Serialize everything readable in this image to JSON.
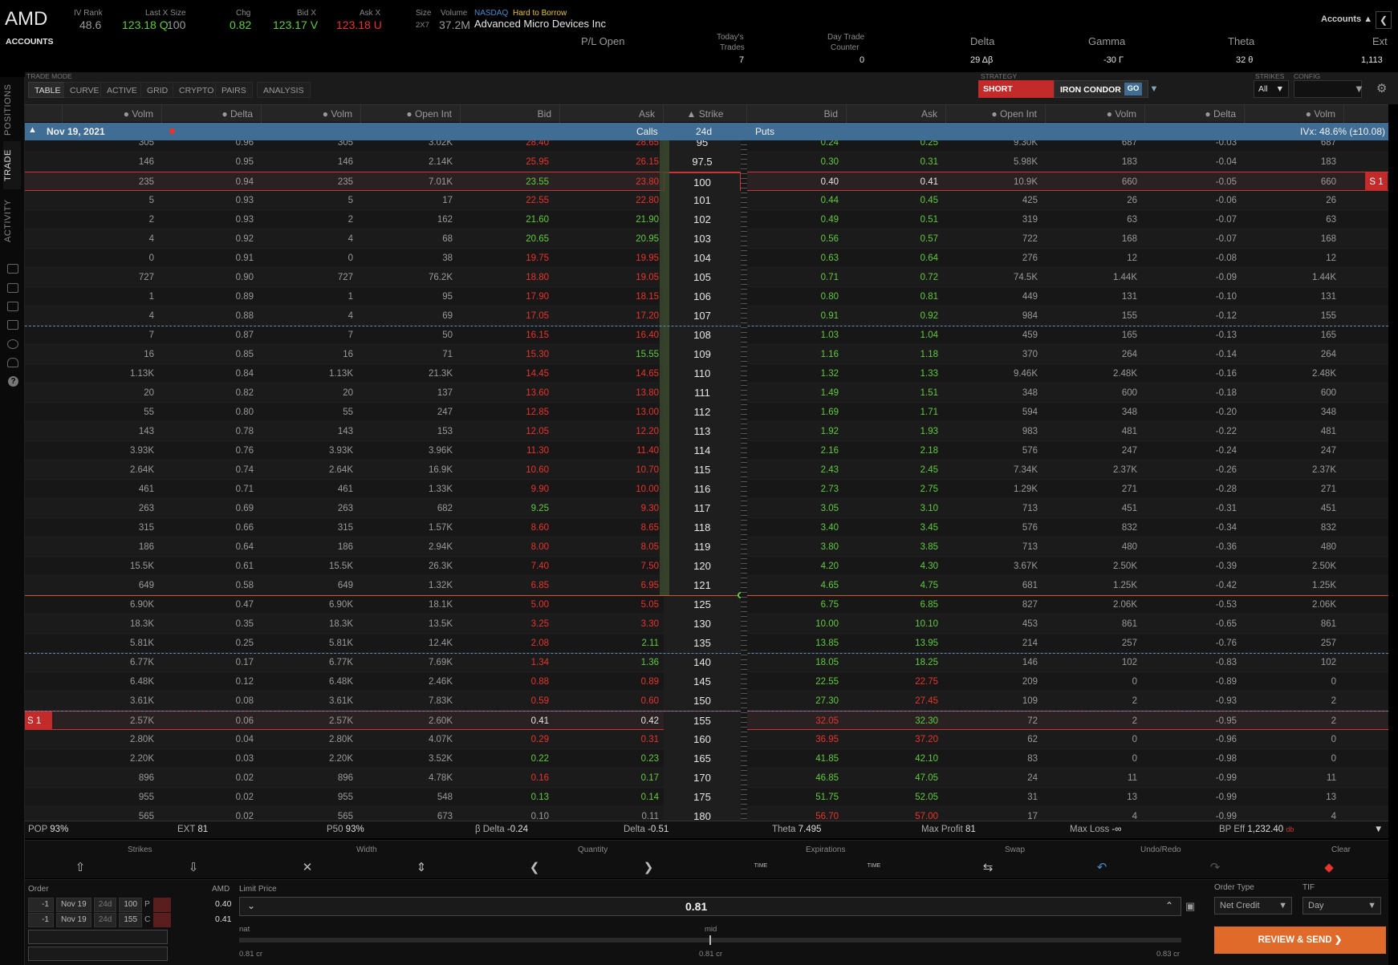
{
  "header": {
    "symbol": "AMD",
    "accounts_label": "ACCOUNTS",
    "iv_rank_label": "IV Rank",
    "iv_rank": "48.6",
    "last_label": "Last X Size",
    "last": "123.18 Q",
    "last_size": "100",
    "chg_label": "Chg",
    "chg": "0.82",
    "bid_label": "Bid X",
    "bid": "123.17 V",
    "ask_label": "Ask X",
    "ask": "123.18 U",
    "size_label": "Size",
    "size": "2X7",
    "volume_label": "Volume",
    "volume": "37.2M",
    "exchange": "NASDAQ",
    "htb": "Hard to Borrow",
    "company": "Advanced Micro Devices Inc",
    "accounts_btn": "Accounts",
    "pl_open_label": "P/L Open",
    "todays_trades_label1": "Today's",
    "todays_trades_label2": "Trades",
    "todays_trades": "7",
    "dtc_label1": "Day Trade",
    "dtc_label2": "Counter",
    "dtc": "0",
    "delta_label": "Delta",
    "delta": "29 Δβ",
    "gamma_label": "Gamma",
    "gamma": "-30 Γ",
    "theta_label": "Theta",
    "theta": "32 θ",
    "ext_label": "Ext",
    "ext": "1,113"
  },
  "sidebar": {
    "tabs": [
      "POSITIONS",
      "TRADE",
      "ACTIVITY"
    ]
  },
  "trade_mode": {
    "label": "TRADE MODE",
    "modes": [
      "TABLE",
      "CURVE",
      "ACTIVE",
      "GRID",
      "CRYPTO",
      "PAIRS",
      "ANALYSIS"
    ],
    "strategy_label": "STRATEGY",
    "side": "SHORT",
    "strategy": "IRON CONDOR",
    "go": "GO",
    "strikes_label": "STRIKES",
    "strikes": "All",
    "config_label": "CONFIG"
  },
  "columns": {
    "calls": [
      "Volm",
      "Delta",
      "Volm",
      "Open Int",
      "Bid",
      "Ask"
    ],
    "strike": "Strike",
    "puts": [
      "Bid",
      "Ask",
      "Open Int",
      "Volm",
      "Delta",
      "Volm"
    ]
  },
  "expiration": {
    "date": "Nov 19, 2021",
    "calls": "Calls",
    "days": "24d",
    "puts": "Puts",
    "ivx": "IVx: 48.6% (±10.08)"
  },
  "chain": [
    [
      "305",
      "0.96",
      "305",
      "3.02K",
      "28.40",
      "28.65",
      "95",
      "0.24",
      "0.25",
      "9.30K",
      "687",
      "-0.03",
      "687"
    ],
    [
      "146",
      "0.95",
      "146",
      "2.14K",
      "25.95",
      "26.15",
      "97.5",
      "0.30",
      "0.31",
      "5.98K",
      "183",
      "-0.04",
      "183"
    ],
    [
      "235",
      "0.94",
      "235",
      "7.01K",
      "23.55",
      "23.80",
      "100",
      "0.40",
      "0.41",
      "10.9K",
      "660",
      "-0.05",
      "660"
    ],
    [
      "5",
      "0.93",
      "5",
      "17",
      "22.55",
      "22.80",
      "101",
      "0.44",
      "0.45",
      "425",
      "26",
      "-0.06",
      "26"
    ],
    [
      "2",
      "0.93",
      "2",
      "162",
      "21.60",
      "21.90",
      "102",
      "0.49",
      "0.51",
      "319",
      "63",
      "-0.07",
      "63"
    ],
    [
      "4",
      "0.92",
      "4",
      "68",
      "20.65",
      "20.95",
      "103",
      "0.56",
      "0.57",
      "722",
      "168",
      "-0.07",
      "168"
    ],
    [
      "0",
      "0.91",
      "0",
      "38",
      "19.75",
      "19.95",
      "104",
      "0.63",
      "0.64",
      "276",
      "12",
      "-0.08",
      "12"
    ],
    [
      "727",
      "0.90",
      "727",
      "76.2K",
      "18.80",
      "19.05",
      "105",
      "0.71",
      "0.72",
      "74.5K",
      "1.44K",
      "-0.09",
      "1.44K"
    ],
    [
      "1",
      "0.89",
      "1",
      "95",
      "17.90",
      "18.15",
      "106",
      "0.80",
      "0.81",
      "449",
      "131",
      "-0.10",
      "131"
    ],
    [
      "4",
      "0.88",
      "4",
      "69",
      "17.05",
      "17.20",
      "107",
      "0.91",
      "0.92",
      "984",
      "155",
      "-0.12",
      "155"
    ],
    [
      "7",
      "0.87",
      "7",
      "50",
      "16.15",
      "16.40",
      "108",
      "1.03",
      "1.04",
      "459",
      "165",
      "-0.13",
      "165"
    ],
    [
      "16",
      "0.85",
      "16",
      "71",
      "15.30",
      "15.55",
      "109",
      "1.16",
      "1.18",
      "370",
      "264",
      "-0.14",
      "264"
    ],
    [
      "1.13K",
      "0.84",
      "1.13K",
      "21.3K",
      "14.45",
      "14.65",
      "110",
      "1.32",
      "1.33",
      "9.46K",
      "2.48K",
      "-0.16",
      "2.48K"
    ],
    [
      "20",
      "0.82",
      "20",
      "137",
      "13.60",
      "13.80",
      "111",
      "1.49",
      "1.51",
      "348",
      "600",
      "-0.18",
      "600"
    ],
    [
      "55",
      "0.80",
      "55",
      "247",
      "12.85",
      "13.00",
      "112",
      "1.69",
      "1.71",
      "594",
      "348",
      "-0.20",
      "348"
    ],
    [
      "143",
      "0.78",
      "143",
      "153",
      "12.05",
      "12.20",
      "113",
      "1.92",
      "1.93",
      "983",
      "481",
      "-0.22",
      "481"
    ],
    [
      "3.93K",
      "0.76",
      "3.93K",
      "3.96K",
      "11.30",
      "11.40",
      "114",
      "2.16",
      "2.18",
      "576",
      "247",
      "-0.24",
      "247"
    ],
    [
      "2.64K",
      "0.74",
      "2.64K",
      "16.9K",
      "10.60",
      "10.70",
      "115",
      "2.43",
      "2.45",
      "7.34K",
      "2.37K",
      "-0.26",
      "2.37K"
    ],
    [
      "461",
      "0.71",
      "461",
      "1.33K",
      "9.90",
      "10.00",
      "116",
      "2.73",
      "2.75",
      "1.29K",
      "271",
      "-0.28",
      "271"
    ],
    [
      "263",
      "0.69",
      "263",
      "682",
      "9.25",
      "9.30",
      "117",
      "3.05",
      "3.10",
      "713",
      "451",
      "-0.31",
      "451"
    ],
    [
      "315",
      "0.66",
      "315",
      "1.57K",
      "8.60",
      "8.65",
      "118",
      "3.40",
      "3.45",
      "576",
      "832",
      "-0.34",
      "832"
    ],
    [
      "186",
      "0.64",
      "186",
      "2.94K",
      "8.00",
      "8.05",
      "119",
      "3.80",
      "3.85",
      "713",
      "480",
      "-0.36",
      "480"
    ],
    [
      "15.5K",
      "0.61",
      "15.5K",
      "26.3K",
      "7.40",
      "7.50",
      "120",
      "4.20",
      "4.30",
      "3.67K",
      "2.50K",
      "-0.39",
      "2.50K"
    ],
    [
      "649",
      "0.58",
      "649",
      "1.32K",
      "6.85",
      "6.95",
      "121",
      "4.65",
      "4.75",
      "681",
      "1.25K",
      "-0.42",
      "1.25K"
    ],
    [
      "6.90K",
      "0.47",
      "6.90K",
      "18.1K",
      "5.00",
      "5.05",
      "125",
      "6.75",
      "6.85",
      "827",
      "2.06K",
      "-0.53",
      "2.06K"
    ],
    [
      "18.3K",
      "0.35",
      "18.3K",
      "13.5K",
      "3.25",
      "3.30",
      "130",
      "10.00",
      "10.10",
      "453",
      "861",
      "-0.65",
      "861"
    ],
    [
      "5.81K",
      "0.25",
      "5.81K",
      "12.4K",
      "2.08",
      "2.11",
      "135",
      "13.85",
      "13.95",
      "214",
      "257",
      "-0.76",
      "257"
    ],
    [
      "6.77K",
      "0.17",
      "6.77K",
      "7.69K",
      "1.34",
      "1.36",
      "140",
      "18.05",
      "18.25",
      "146",
      "102",
      "-0.83",
      "102"
    ],
    [
      "6.48K",
      "0.12",
      "6.48K",
      "2.46K",
      "0.88",
      "0.89",
      "145",
      "22.55",
      "22.75",
      "209",
      "0",
      "-0.89",
      "0"
    ],
    [
      "3.61K",
      "0.08",
      "3.61K",
      "7.83K",
      "0.59",
      "0.60",
      "150",
      "27.30",
      "27.45",
      "109",
      "2",
      "-0.93",
      "2"
    ],
    [
      "2.57K",
      "0.06",
      "2.57K",
      "2.60K",
      "0.41",
      "0.42",
      "155",
      "32.05",
      "32.30",
      "72",
      "2",
      "-0.95",
      "2"
    ],
    [
      "2.80K",
      "0.04",
      "2.80K",
      "4.07K",
      "0.29",
      "0.31",
      "160",
      "36.95",
      "37.20",
      "62",
      "0",
      "-0.96",
      "0"
    ],
    [
      "2.20K",
      "0.03",
      "2.20K",
      "3.52K",
      "0.22",
      "0.23",
      "165",
      "41.85",
      "42.10",
      "83",
      "0",
      "-0.98",
      "0"
    ],
    [
      "896",
      "0.02",
      "896",
      "4.78K",
      "0.16",
      "0.17",
      "170",
      "46.85",
      "47.05",
      "24",
      "11",
      "-0.99",
      "11"
    ],
    [
      "955",
      "0.02",
      "955",
      "548",
      "0.13",
      "0.14",
      "175",
      "51.75",
      "52.05",
      "31",
      "13",
      "-0.99",
      "13"
    ],
    [
      "565",
      "0.02",
      "565",
      "673",
      "0.10",
      "0.11",
      "180",
      "56.70",
      "57.00",
      "17",
      "4",
      "-0.99",
      "4"
    ]
  ],
  "selection": {
    "s1": "S 1"
  },
  "stats": {
    "pop_l": "POP",
    "pop": "93%",
    "ext_l": "EXT",
    "ext": "81",
    "p50_l": "P50",
    "p50": "93%",
    "bdelta_l": "β Delta",
    "bdelta": "-0.24",
    "delta_l": "Delta",
    "delta": "-0.51",
    "theta_l": "Theta",
    "theta": "7.495",
    "maxp_l": "Max Profit",
    "maxp": "81",
    "maxl_l": "Max Loss",
    "maxl": "-∞",
    "bp_l": "BP Eff",
    "bp": "1,232.40",
    "bp_u": "db"
  },
  "tools": {
    "labels": [
      "Strikes",
      "Width",
      "Quantity",
      "Expirations",
      "Swap",
      "Undo/Redo",
      "Clear"
    ],
    "time": "TIME"
  },
  "order": {
    "order_label": "Order",
    "sym_label": "AMD",
    "legs": [
      {
        "qty": "-1",
        "exp": "Nov 19",
        "dte": "24d",
        "strike": "100",
        "type": "P",
        "price": "0.40"
      },
      {
        "qty": "-1",
        "exp": "Nov 19",
        "dte": "24d",
        "strike": "155",
        "type": "C",
        "price": "0.41"
      }
    ],
    "limit_label": "Limit Price",
    "limit": "0.81",
    "nat_label": "nat",
    "mid_label": "mid",
    "nat": "0.81 cr",
    "mid": "0.81 cr",
    "far": "0.83 cr",
    "otype_label": "Order Type",
    "otype": "Net Credit",
    "tif_label": "TIF",
    "tif": "Day",
    "review": "REVIEW & SEND"
  }
}
